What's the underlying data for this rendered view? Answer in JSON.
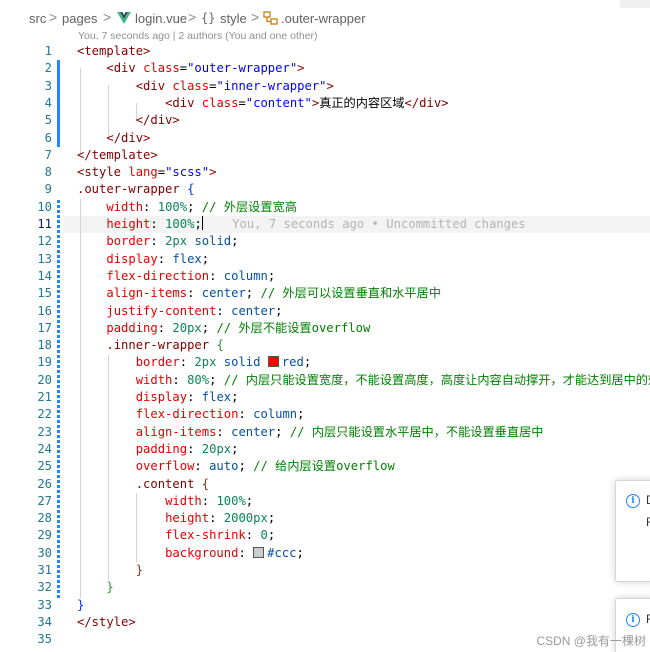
{
  "breadcrumb": {
    "parts": [
      "src",
      "pages",
      "login.vue",
      "style",
      ".outer-wrapper"
    ],
    "separator": ">"
  },
  "blame": {
    "text": "You, 7 seconds ago | 2 authors (You and one other)"
  },
  "editor": {
    "active_line": 11,
    "inline_blame": "You, 7 seconds ago • Uncommitted changes",
    "line_numbers": [
      "1",
      "2",
      "3",
      "4",
      "5",
      "6",
      "7",
      "8",
      "9",
      "10",
      "11",
      "12",
      "13",
      "14",
      "15",
      "16",
      "17",
      "18",
      "19",
      "20",
      "21",
      "22",
      "23",
      "24",
      "25",
      "26",
      "27",
      "28",
      "29",
      "30",
      "31",
      "32",
      "33",
      "34",
      "35"
    ]
  },
  "colors": {
    "red_swatch": "#ff0000",
    "ccc_swatch": "#cccccc",
    "line_number": "#237893",
    "tag": "#800000",
    "attribute": "#e50000",
    "string": "#0000ff",
    "comment": "#008000",
    "modified_bar": "#2188ff"
  },
  "notifications": [
    {
      "icon": "info-icon",
      "text": "D",
      "subtext": "R"
    },
    {
      "icon": "info-icon",
      "text": "F"
    }
  ],
  "watermark": "CSDN @我有一棵树"
}
